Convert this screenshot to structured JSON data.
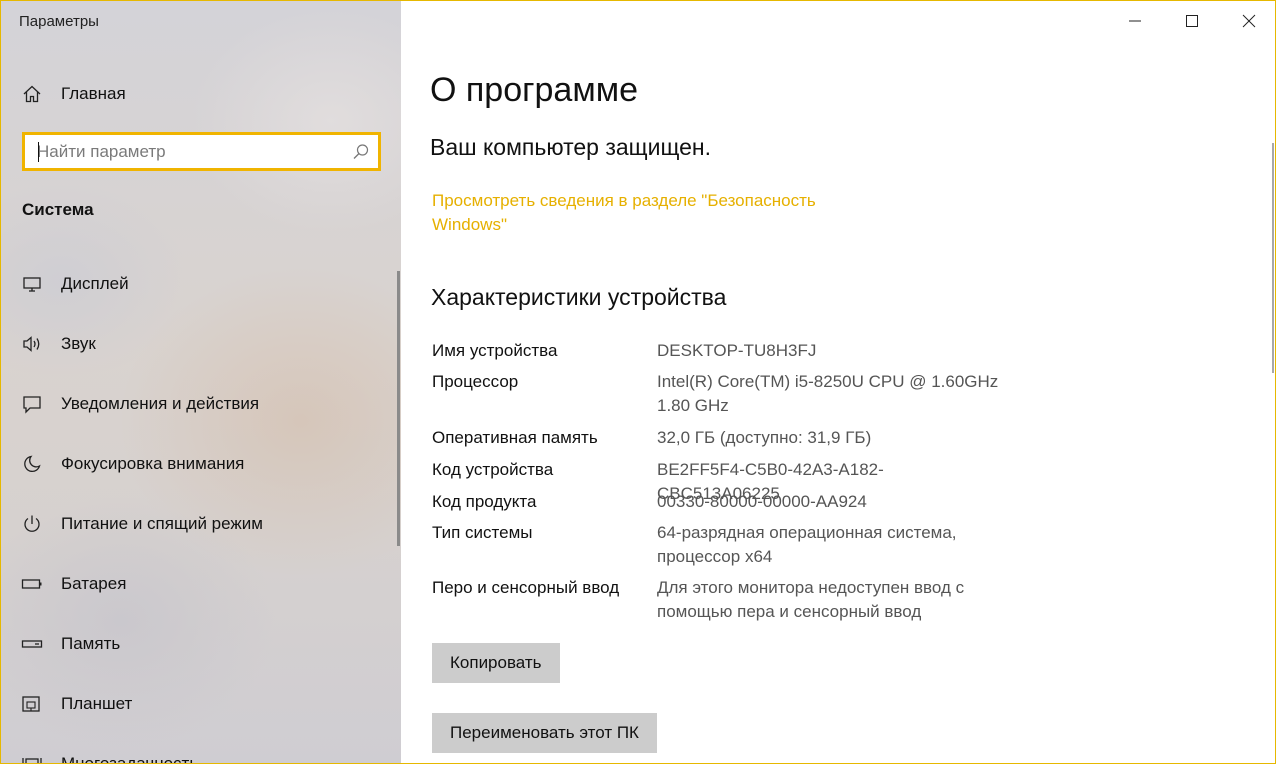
{
  "app": {
    "title": "Параметры"
  },
  "sidebar": {
    "home_label": "Главная",
    "search_placeholder": "Найти параметр",
    "section_title": "Система",
    "items": [
      {
        "label": "Дисплей",
        "icon": "display-icon"
      },
      {
        "label": "Звук",
        "icon": "speaker-icon"
      },
      {
        "label": "Уведомления и действия",
        "icon": "notification-icon"
      },
      {
        "label": "Фокусировка внимания",
        "icon": "moon-icon"
      },
      {
        "label": "Питание и спящий режим",
        "icon": "power-icon"
      },
      {
        "label": "Батарея",
        "icon": "battery-icon"
      },
      {
        "label": "Память",
        "icon": "storage-icon"
      },
      {
        "label": "Планшет",
        "icon": "tablet-icon"
      },
      {
        "label": "Многозадачность",
        "icon": "multitasking-icon"
      }
    ]
  },
  "main": {
    "page_title": "О программе",
    "protected_text": "Ваш компьютер защищен.",
    "security_link": "Просмотреть сведения в разделе \"Безопасность Windows\"",
    "specs_title": "Характеристики устройства",
    "specs": [
      {
        "label": "Имя устройства",
        "value": "DESKTOP-TU8H3FJ"
      },
      {
        "label": "Процессор",
        "value": "Intel(R) Core(TM) i5-8250U CPU @ 1.60GHz 1.80 GHz"
      },
      {
        "label": "Оперативная память",
        "value": "32,0 ГБ (доступно: 31,9 ГБ)"
      },
      {
        "label": "Код устройства",
        "value": "BE2FF5F4-C5B0-42A3-A182-CBC513A06225"
      },
      {
        "label": "Код продукта",
        "value": "00330-80000-00000-AA924"
      },
      {
        "label": "Тип системы",
        "value": "64-разрядная операционная система, процессор x64"
      },
      {
        "label": "Перо и сенсорный ввод",
        "value": "Для этого монитора недоступен ввод с помощью пера и сенсорный ввод"
      }
    ],
    "copy_button": "Копировать",
    "rename_button": "Переименовать этот ПК"
  },
  "colors": {
    "accent": "#f0b400",
    "link": "#e6b000",
    "button_bg": "#cccccc",
    "secondary_text": "#555555"
  }
}
